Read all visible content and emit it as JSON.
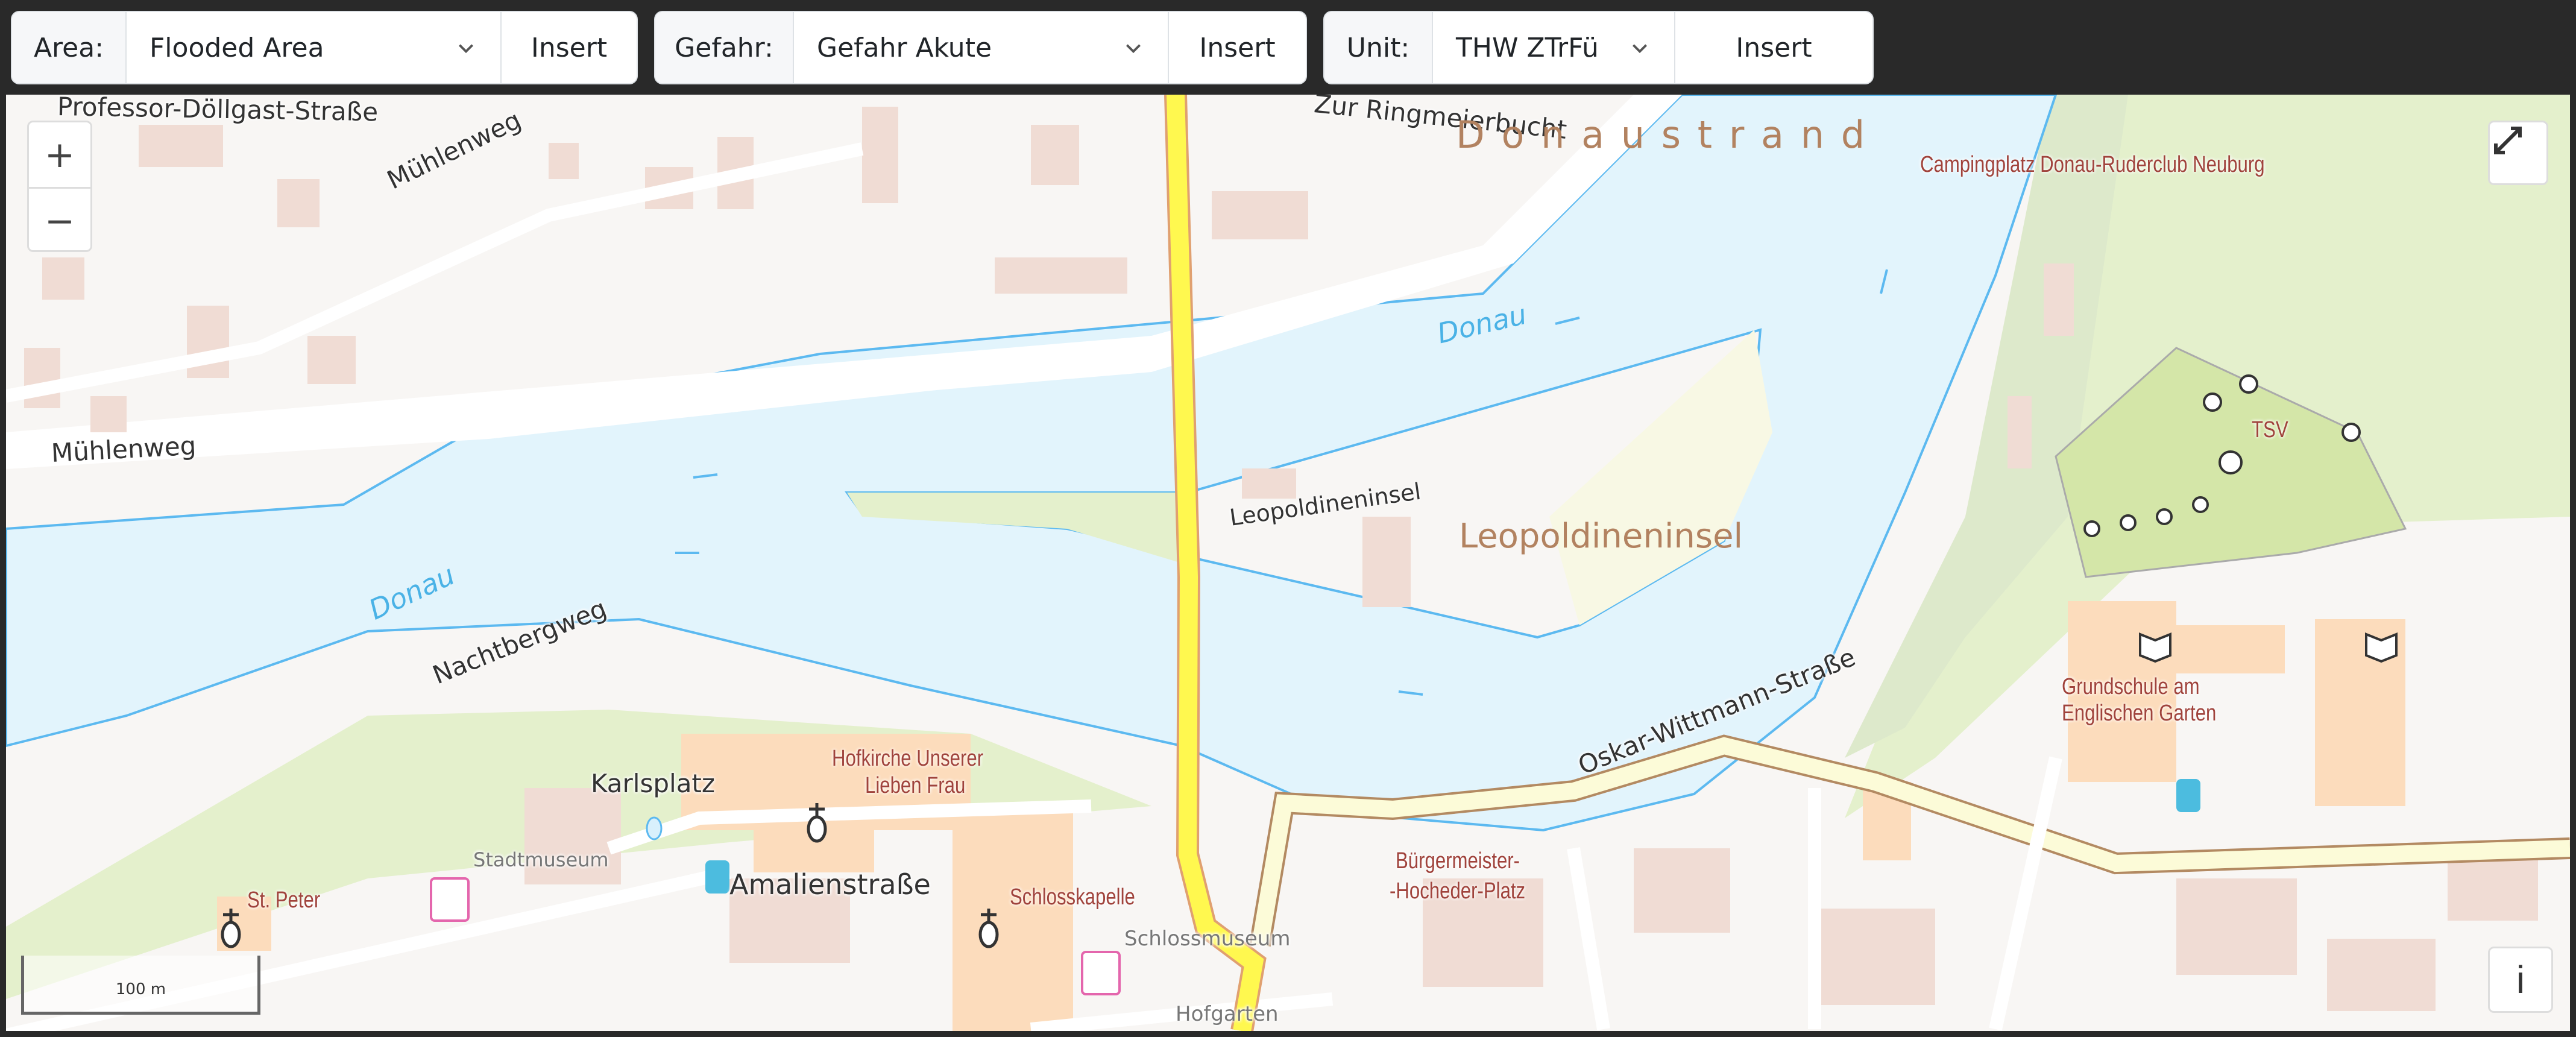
{
  "toolbar": {
    "groups": [
      {
        "label": "Area:",
        "selected": "Flooded Area",
        "button": "Insert"
      },
      {
        "label": "Gefahr:",
        "selected": "Gefahr Akute",
        "button": "Insert"
      },
      {
        "label": "Unit:",
        "selected": "THW ZTrFü",
        "button": "Insert"
      }
    ]
  },
  "map": {
    "controls": {
      "zoom_in": "+",
      "zoom_out": "−",
      "fullscreen_icon": "fullscreen-icon",
      "info": "i"
    },
    "scale_bar": "100 m",
    "labels": {
      "street_professor": "Professor-Döllgast-Straße",
      "street_muehlenweg_1": "Mühlenweg",
      "street_muehlenweg_2": "Mühlenweg",
      "street_ringmeier": "Zur Ringmeierbucht",
      "area_donaustrand": "D o n a u s t r a n d",
      "poi_camping": "Campingplatz Donau-Ruderclub Neuburg",
      "water_donau_1": "Donau",
      "water_donau_2": "Donau",
      "street_leopold": "Leopoldineninsel",
      "area_leopold": "Leopoldineninsel",
      "street_nachtberg": "Nachtbergweg",
      "poi_tsv": "TSV",
      "poi_school": "Grundschule am\nEnglischen Garten",
      "street_oskar": "Oskar-Wittmann-Straße",
      "poi_hofkirche_1": "Hofkirche Unserer",
      "poi_hofkirche_2": "Lieben Frau",
      "street_karlsplatz": "Karlsplatz",
      "street_stadtmuseum": "Stadtmuseum",
      "poi_stpeter": "St. Peter",
      "street_amalien": "Amalienstraße",
      "poi_schlosskapelle": "Schlosskapelle",
      "street_schlossmuseum": "Schlossmuseum",
      "poi_buergermeister_1": "Bürgermeister-",
      "poi_buergermeister_2": "-Hocheder-Platz",
      "street_hofgarten": "Hofgarten"
    },
    "colors": {
      "water": "#e2f4fc",
      "water_outline": "#5cb9f0",
      "highlight_route": "#fff84f",
      "building": "#f0dcd4",
      "poi_building": "#fcdcbc",
      "park": "#e4f0cc",
      "sports": "#d4e6a8"
    }
  }
}
